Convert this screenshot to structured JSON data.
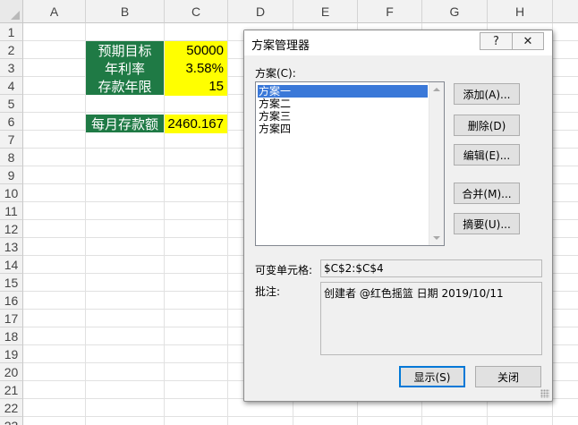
{
  "sheet": {
    "columns": [
      "A",
      "B",
      "C",
      "D",
      "E",
      "F",
      "G",
      "H"
    ],
    "rows": [
      "1",
      "2",
      "3",
      "4",
      "5",
      "6",
      "7",
      "8",
      "9",
      "10",
      "11",
      "12",
      "13",
      "14",
      "15",
      "16",
      "17",
      "18",
      "19",
      "20",
      "21",
      "22",
      "23"
    ],
    "cells": {
      "b2": "预期目标",
      "c2": "50000",
      "b3": "年利率",
      "c3": "3.58%",
      "b4": "存款年限",
      "c4": "15",
      "b6": "每月存款额",
      "c6": "2460.167"
    },
    "colors": {
      "label_bg": "#1f7a45",
      "value_bg": "#ffff00"
    }
  },
  "dialog": {
    "title": "方案管理器",
    "help_label": "?",
    "close_label": "✕",
    "scenarios_label": "方案(C):",
    "scenarios": [
      "方案一",
      "方案二",
      "方案三",
      "方案四"
    ],
    "selected_index": 0,
    "buttons": {
      "add": "添加(A)...",
      "delete": "删除(D)",
      "edit": "编辑(E)...",
      "merge": "合并(M)...",
      "summary": "摘要(U)...",
      "show": "显示(S)",
      "close": "关闭"
    },
    "changing_cells_label": "可变单元格:",
    "changing_cells": "$C$2:$C$4",
    "comment_label": "批注:",
    "comment": "创建者 @红色摇篮 日期 2019/10/11",
    "accent_color": "#3a78d8"
  }
}
